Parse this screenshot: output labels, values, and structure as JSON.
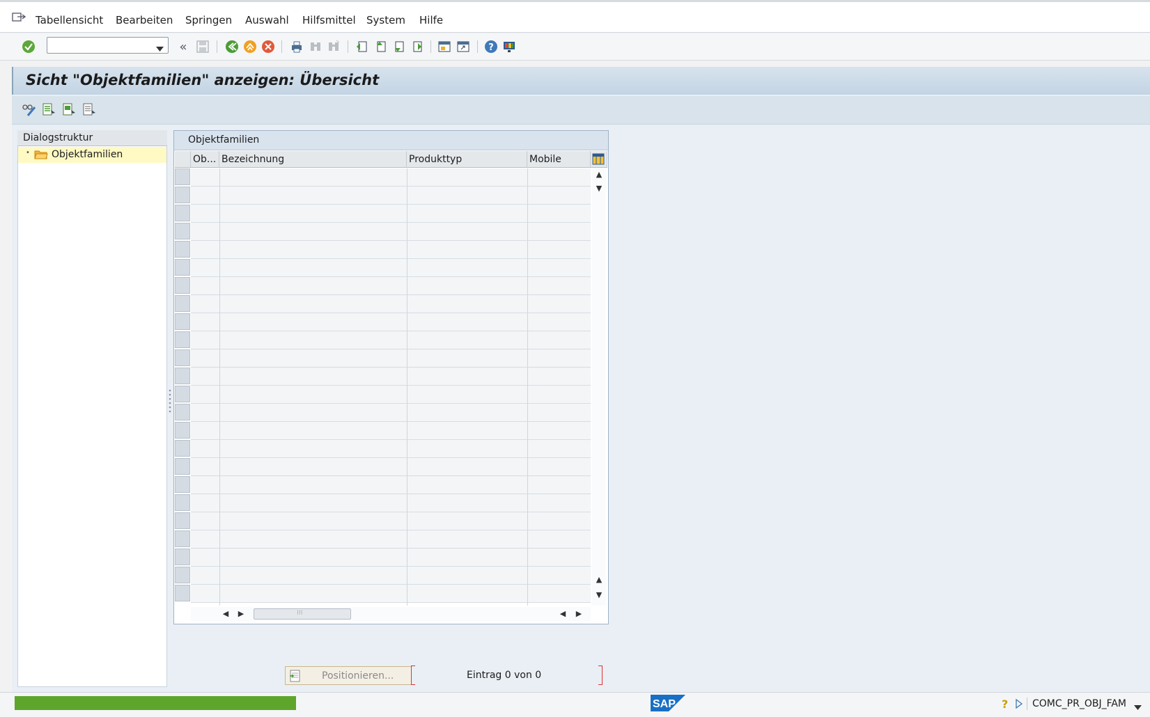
{
  "menu": {
    "items": [
      {
        "label": "Tabellensicht"
      },
      {
        "label": "Bearbeiten"
      },
      {
        "label": "Springen"
      },
      {
        "label": "Auswahl"
      },
      {
        "label": "Hilfsmittel"
      },
      {
        "label": "System"
      },
      {
        "label": "Hilfe"
      }
    ]
  },
  "toolbar": {
    "command_field_value": ""
  },
  "page": {
    "title": "Sicht \"Objektfamilien\" anzeigen: Übersicht"
  },
  "dialog_structure": {
    "header": "Dialogstruktur",
    "items": [
      {
        "label": "Objektfamilien"
      }
    ]
  },
  "table": {
    "title": "Objektfamilien",
    "columns": [
      "Ob...",
      "Bezeichnung",
      "Produkttyp",
      "Mobile"
    ],
    "rows": []
  },
  "footer": {
    "position_button": "Positionieren...",
    "entry_text": "Eintrag 0 von 0"
  },
  "status": {
    "system": "COMC_PR_OBJ_FAM",
    "logo": "SAP"
  },
  "colors": {
    "progress": "#5ea52c",
    "title_bar": "#c3d4e4",
    "selected_node": "#fff9c4"
  }
}
